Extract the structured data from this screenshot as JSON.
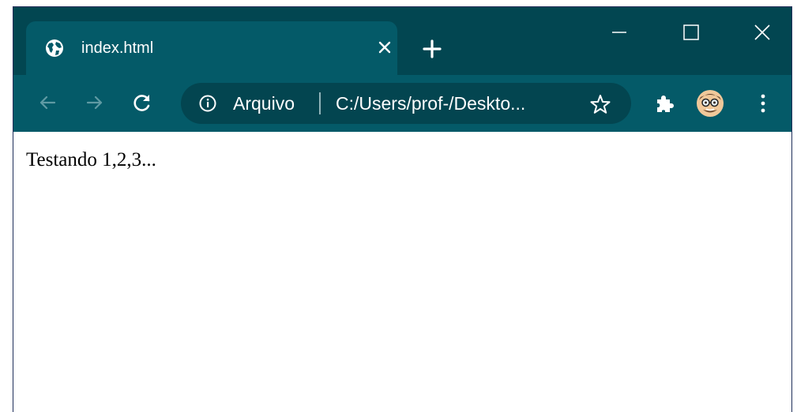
{
  "tab": {
    "title": "index.html",
    "favicon": "globe-icon",
    "close": "close-icon"
  },
  "window_controls": {
    "minimize": "minimize-icon",
    "maximize": "maximize-icon",
    "close": "close-icon"
  },
  "toolbar": {
    "back": "back-arrow-icon",
    "forward": "forward-arrow-icon",
    "reload": "reload-icon",
    "extensions": "puzzle-icon",
    "menu": "kebab-menu-icon"
  },
  "omnibox": {
    "security_label": "Arquivo",
    "url": "C:/Users/prof-/Deskto...",
    "bookmark": "star-icon"
  },
  "page": {
    "text": "Testando 1,2,3..."
  },
  "colors": {
    "titlebar": "#024651",
    "toolbar": "#045a68",
    "omnibox": "#034550",
    "accent": "#ffffff"
  }
}
